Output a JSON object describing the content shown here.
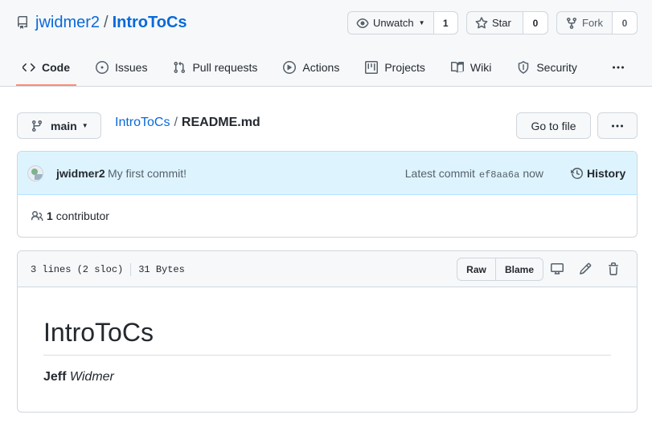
{
  "repo": {
    "owner": "jwidmer2",
    "separator": "/",
    "name": "IntroToCs"
  },
  "header_buttons": {
    "watch": {
      "label": "Unwatch",
      "count": "1"
    },
    "star": {
      "label": "Star",
      "count": "0"
    },
    "fork": {
      "label": "Fork",
      "count": "0"
    }
  },
  "tabs": [
    {
      "label": "Code",
      "icon": "code-icon",
      "active": true
    },
    {
      "label": "Issues",
      "icon": "issue-opened-icon"
    },
    {
      "label": "Pull requests",
      "icon": "git-pull-request-icon"
    },
    {
      "label": "Actions",
      "icon": "play-icon"
    },
    {
      "label": "Projects",
      "icon": "project-icon"
    },
    {
      "label": "Wiki",
      "icon": "book-icon"
    },
    {
      "label": "Security",
      "icon": "shield-icon"
    }
  ],
  "file_nav": {
    "branch": "main",
    "breadcrumb_repo": "IntroToCs",
    "breadcrumb_sep": "/",
    "breadcrumb_file": "README.md",
    "goto_file": "Go to file"
  },
  "commit": {
    "author": "jwidmer2",
    "message": "My first commit!",
    "latest_label": "Latest commit",
    "sha": "ef8aa6a",
    "time": "now",
    "history_label": "History"
  },
  "contributors": {
    "count": "1",
    "label": "contributor"
  },
  "file": {
    "lines": "3 lines (2 sloc)",
    "size": "31 Bytes",
    "raw_label": "Raw",
    "blame_label": "Blame"
  },
  "readme": {
    "heading": "IntroToCs",
    "first_name": "Jeff",
    "last_name": "Widmer"
  },
  "colors": {
    "link": "#0969da",
    "active_tab_underline": "#fd8c73",
    "commit_bar_bg": "#ddf4ff"
  }
}
